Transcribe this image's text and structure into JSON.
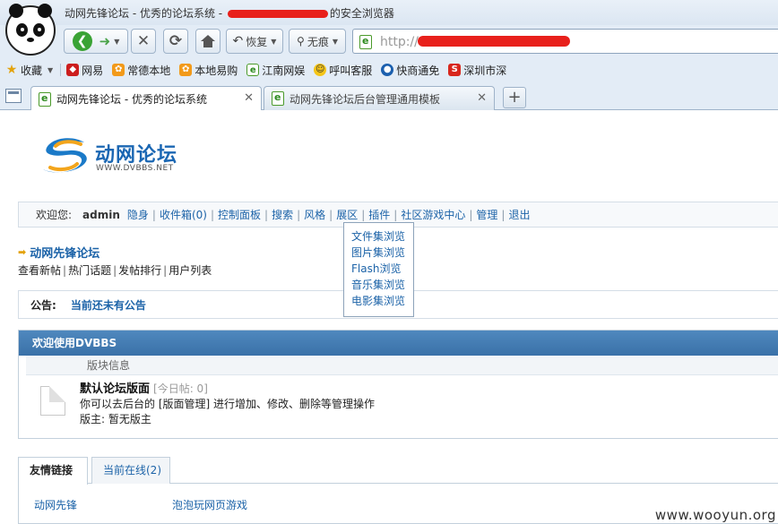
{
  "window": {
    "title_prefix": "动网先锋论坛 - 优秀的论坛系统 - ",
    "title_suffix": "的安全浏览器"
  },
  "toolbar": {
    "restore_label": "恢复",
    "private_label": "无痕",
    "url_text": "http://"
  },
  "bookmarks": {
    "favorites_label": "收藏",
    "items": [
      "网易",
      "常德本地",
      "本地易购",
      "江南网娱",
      "呼叫客服",
      "快商通免",
      "深圳市深"
    ]
  },
  "tabs": [
    {
      "label": "动网先锋论坛 - 优秀的论坛系统"
    },
    {
      "label": "动网先锋论坛后台管理通用模板"
    }
  ],
  "logo": {
    "cn": "动网论坛",
    "en": "WWW.DVBBS.NET"
  },
  "menubar": {
    "welcome": "欢迎您:",
    "user": "admin",
    "items": [
      "隐身",
      "收件箱(0)",
      "控制面板",
      "搜索",
      "风格",
      "展区",
      "插件",
      "社区游戏中心",
      "管理",
      "退出"
    ]
  },
  "dropdown": {
    "items": [
      "文件集浏览",
      "图片集浏览",
      "Flash浏览",
      "音乐集浏览",
      "电影集浏览"
    ]
  },
  "breadcrumb": {
    "title": "动网先锋论坛",
    "links": [
      "查看新帖",
      "热门话题",
      "发帖排行",
      "用户列表"
    ]
  },
  "notice": {
    "label": "公告:",
    "text": "当前还未有公告"
  },
  "forum": {
    "header": "欢迎使用DVBBS",
    "column": "版块信息",
    "board_name": "默认论坛版面",
    "board_today": "[今日帖: 0]",
    "board_desc": "你可以去后台的 [版面管理] 进行增加、修改、删除等管理操作",
    "board_mod": "版主: 暂无版主"
  },
  "links_section": {
    "tab_active": "友情链接",
    "tab_online": "当前在线(2)",
    "links": [
      "动网先锋",
      "泡泡玩网页游戏"
    ]
  },
  "watermark": "www.wooyun.org",
  "colors": {
    "link": "#1c63a8",
    "forum_header": "#3a71a8",
    "redaction": "#e8201b"
  }
}
